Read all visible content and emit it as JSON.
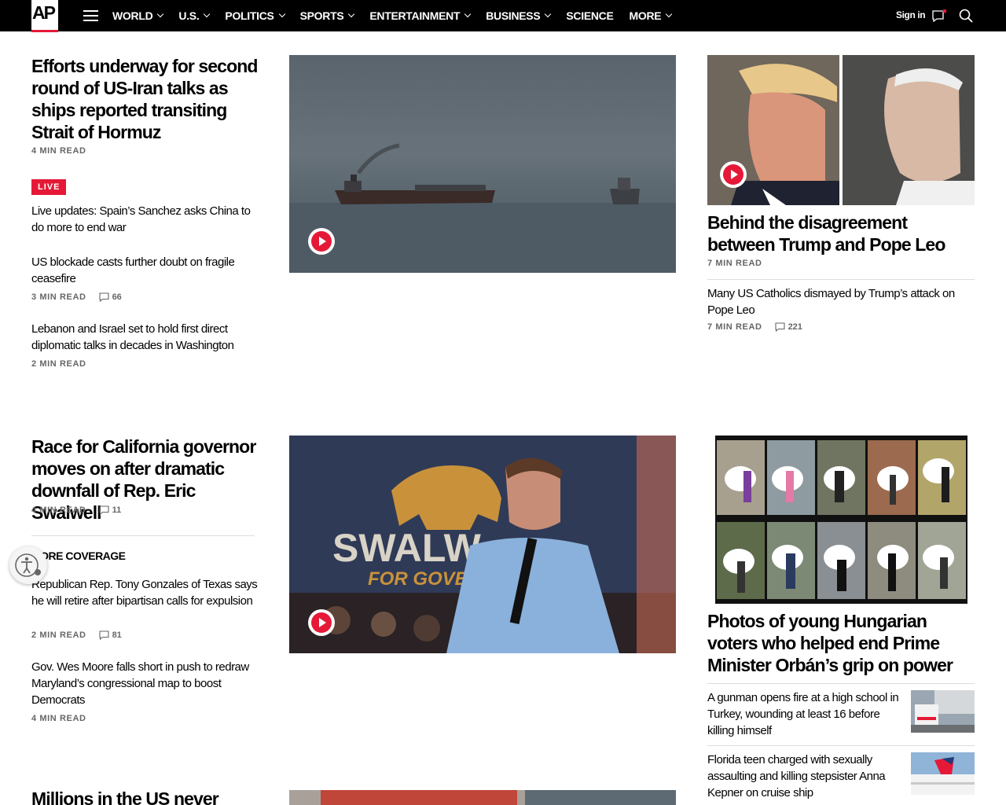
{
  "brand": {
    "logo_text": "AP",
    "accent": "#e51937"
  },
  "nav": {
    "items": [
      {
        "label": "WORLD",
        "has_menu": true
      },
      {
        "label": "U.S.",
        "has_menu": true
      },
      {
        "label": "POLITICS",
        "has_menu": true
      },
      {
        "label": "SPORTS",
        "has_menu": true
      },
      {
        "label": "ENTERTAINMENT",
        "has_menu": true
      },
      {
        "label": "BUSINESS",
        "has_menu": true
      },
      {
        "label": "SCIENCE",
        "has_menu": false
      },
      {
        "label": "MORE",
        "has_menu": true
      }
    ],
    "signin_label": "Sign in"
  },
  "section1": {
    "lead": {
      "title": "Efforts underway for second round of US-Iran talks as ships reported transiting Strait of Hormuz",
      "meta": "4 MIN READ"
    },
    "live_label": "LIVE",
    "stories": [
      {
        "title": "Live updates: Spain’s Sanchez asks China to do more to end war"
      },
      {
        "title": "US blockade casts further doubt on fragile ceasefire",
        "meta": "3 MIN READ",
        "comments": "66"
      },
      {
        "title": "Lebanon and Israel set to hold first direct diplomatic talks in decades in Washington",
        "meta": "2 MIN READ"
      }
    ],
    "right": {
      "title": "Behind the disagreement between Trump and Pope Leo",
      "meta": "7 MIN READ",
      "sub_title": "Many US Catholics dismayed by Trump’s attack on Pope Leo",
      "sub_meta": "7 MIN READ",
      "sub_comments": "221"
    }
  },
  "section2": {
    "lead": {
      "title": "Race for California governor moves on after dramatic downfall of Rep. Eric Swalwell",
      "meta": "4 MIN READ",
      "comments": "11"
    },
    "more_coverage_label": "MORE COVERAGE",
    "stories": [
      {
        "title": "Republican Rep. Tony Gonzales of Texas says he will retire after bipartisan calls for expulsion",
        "meta": "2 MIN READ",
        "comments": "81"
      },
      {
        "title": "Gov. Wes Moore falls short in push to redraw Maryland’s congressional map to boost Democrats",
        "meta": "4 MIN READ"
      }
    ],
    "image_sign_text": "SWALW",
    "image_sign_sub": "FOR GOVE",
    "right": {
      "title": "Photos of young Hungarian voters who helped end Prime Minister Orbán’s grip on power",
      "list": [
        {
          "title": "A gunman opens fire at a high school in Turkey, wounding at least 16 before killing himself"
        },
        {
          "title": "Florida teen charged with sexually assaulting and killing stepsister Anna Kepner on cruise ship"
        }
      ]
    }
  },
  "section3": {
    "lead": {
      "title": "Millions in the US never"
    }
  }
}
